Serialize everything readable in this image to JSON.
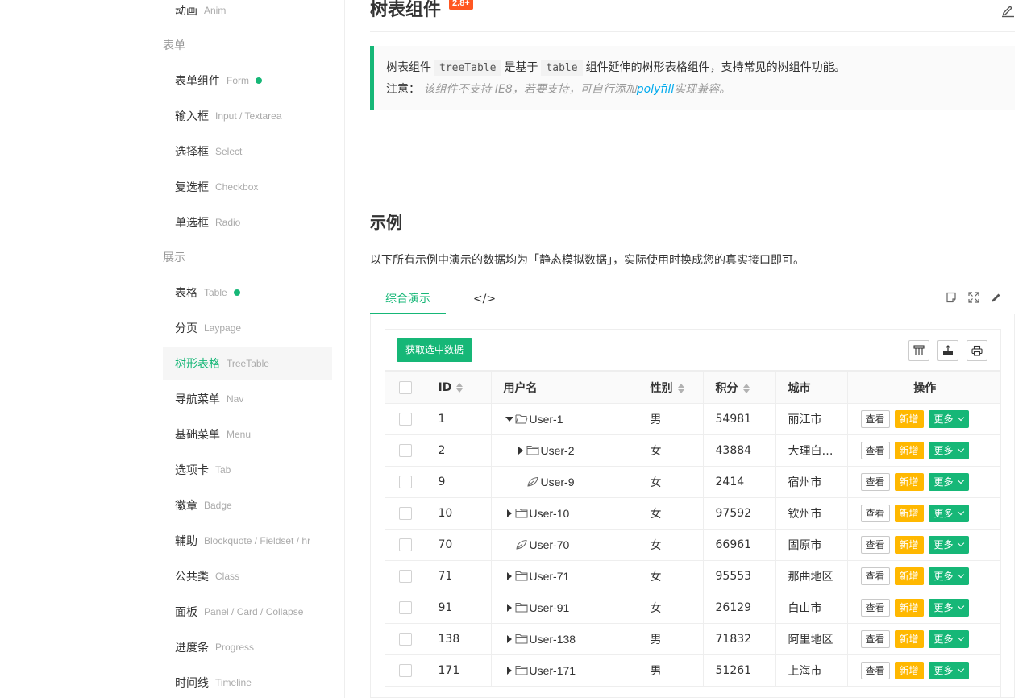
{
  "sidebar": {
    "top_item": {
      "zh": "动画",
      "en": "Anim"
    },
    "groups": [
      {
        "label": "表单",
        "items": [
          {
            "zh": "表单组件",
            "en": "Form",
            "dot": true
          },
          {
            "zh": "输入框",
            "en": "Input / Textarea"
          },
          {
            "zh": "选择框",
            "en": "Select"
          },
          {
            "zh": "复选框",
            "en": "Checkbox"
          },
          {
            "zh": "单选框",
            "en": "Radio"
          }
        ]
      },
      {
        "label": "展示",
        "items": [
          {
            "zh": "表格",
            "en": "Table",
            "dot": true
          },
          {
            "zh": "分页",
            "en": "Laypage"
          },
          {
            "zh": "树形表格",
            "en": "TreeTable",
            "active": true
          },
          {
            "zh": "导航菜单",
            "en": "Nav"
          },
          {
            "zh": "基础菜单",
            "en": "Menu"
          },
          {
            "zh": "选项卡",
            "en": "Tab"
          },
          {
            "zh": "徽章",
            "en": "Badge"
          },
          {
            "zh": "辅助",
            "en": "Blockquote / Fieldset / hr"
          },
          {
            "zh": "公共类",
            "en": "Class"
          },
          {
            "zh": "面板",
            "en": "Panel / Card / Collapse"
          },
          {
            "zh": "进度条",
            "en": "Progress"
          },
          {
            "zh": "时间线",
            "en": "Timeline"
          }
        ]
      }
    ]
  },
  "header": {
    "title": "树表组件",
    "version": "2.8+"
  },
  "intro": {
    "part1": "树表组件",
    "code1": "treeTable",
    "part2": "是基于",
    "code2": "table",
    "part3": "组件延伸的树形表格组件，支持常见的树组件功能。",
    "note_label": "注意：",
    "note_text": "该组件不支持 IE8，若要支持，可自行添加",
    "note_link": "polyfill",
    "note_tail": "实现兼容。"
  },
  "section": {
    "title": "示例",
    "desc": "以下所有示例中演示的数据均为「静态模拟数据」，实际使用时换成您的真实接口即可。"
  },
  "tabs": [
    {
      "label": "综合演示",
      "active": true
    },
    {
      "label": "</>"
    }
  ],
  "toolbar": {
    "get_selected": "获取选中数据"
  },
  "table": {
    "columns": [
      "ID",
      "用户名",
      "性别",
      "积分",
      "城市",
      "操作"
    ],
    "buttons": {
      "view": "查看",
      "add": "新增",
      "more": "更多"
    },
    "rows": [
      {
        "id": "1",
        "name": "User-1",
        "level": 0,
        "type": "open",
        "sex": "男",
        "score": "54981",
        "city": "丽江市"
      },
      {
        "id": "2",
        "name": "User-2",
        "level": 1,
        "type": "closed",
        "sex": "女",
        "score": "43884",
        "city": "大理白族…"
      },
      {
        "id": "9",
        "name": "User-9",
        "level": 1,
        "type": "leaf",
        "sex": "女",
        "score": "2414",
        "city": "宿州市"
      },
      {
        "id": "10",
        "name": "User-10",
        "level": 0,
        "type": "closed",
        "sex": "女",
        "score": "97592",
        "city": "钦州市"
      },
      {
        "id": "70",
        "name": "User-70",
        "level": 0,
        "type": "leaf",
        "sex": "女",
        "score": "66961",
        "city": "固原市"
      },
      {
        "id": "71",
        "name": "User-71",
        "level": 0,
        "type": "closed",
        "sex": "女",
        "score": "95553",
        "city": "那曲地区"
      },
      {
        "id": "91",
        "name": "User-91",
        "level": 0,
        "type": "closed",
        "sex": "女",
        "score": "26129",
        "city": "白山市"
      },
      {
        "id": "138",
        "name": "User-138",
        "level": 0,
        "type": "closed",
        "sex": "男",
        "score": "71832",
        "city": "阿里地区"
      },
      {
        "id": "171",
        "name": "User-171",
        "level": 0,
        "type": "closed",
        "sex": "男",
        "score": "51261",
        "city": "上海市"
      }
    ]
  }
}
